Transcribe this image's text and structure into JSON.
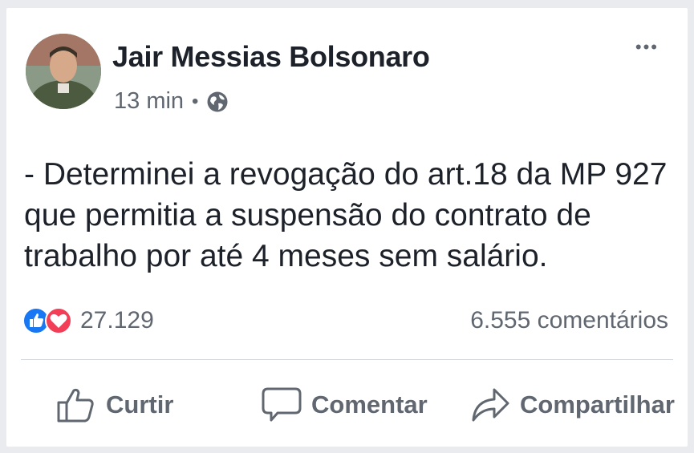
{
  "post": {
    "author": "Jair Messias Bolsonaro",
    "time": "13 min",
    "separator": "•",
    "more_label": "•••",
    "text": "- Determinei a revogação do art.18 da MP 927 que permitia a suspensão do contrato de trabalho por até 4 meses sem salário.",
    "reaction_count": "27.129",
    "comments_count": "6.555 comentários"
  },
  "actions": {
    "like": "Curtir",
    "comment": "Comentar",
    "share": "Compartilhar"
  },
  "icons": {
    "audience": "globe-icon",
    "like_reaction": "like-reaction-icon",
    "love_reaction": "love-reaction-icon",
    "like_action": "thumbs-up-icon",
    "comment_action": "speech-bubble-icon",
    "share_action": "share-arrow-icon"
  },
  "colors": {
    "like_blue": "#1877f2",
    "love_red": "#f33e58",
    "text_dark": "#1d2129",
    "text_gray": "#606770"
  }
}
